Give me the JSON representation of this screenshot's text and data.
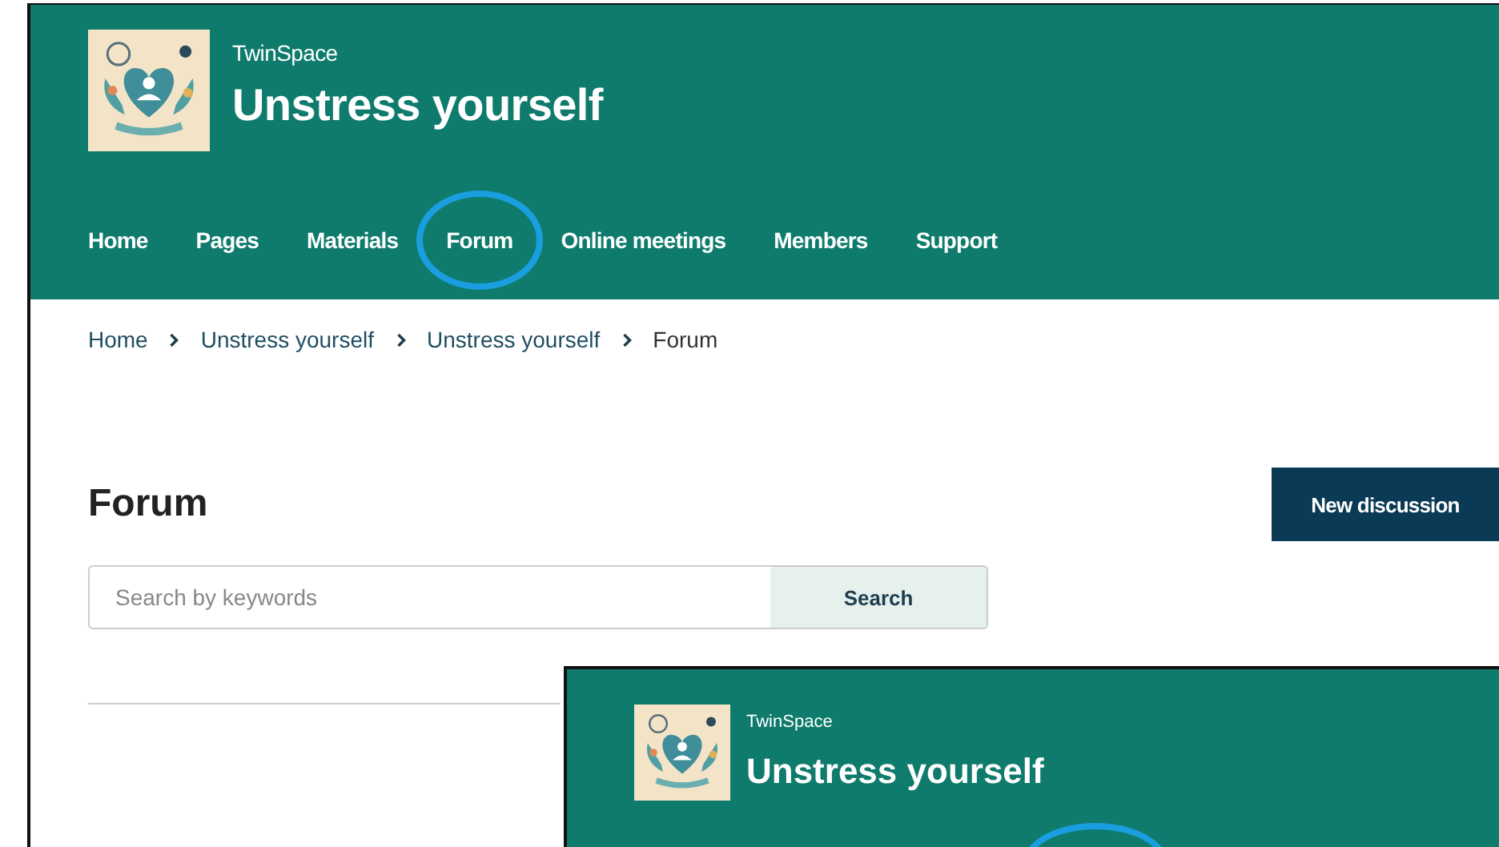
{
  "header": {
    "site_label": "TwinSpace",
    "title": "Unstress yourself"
  },
  "nav": [
    {
      "label": "Home",
      "highlighted": false
    },
    {
      "label": "Pages",
      "highlighted": false
    },
    {
      "label": "Materials",
      "highlighted": false
    },
    {
      "label": "Forum",
      "highlighted": true
    },
    {
      "label": "Online meetings",
      "highlighted": false
    },
    {
      "label": "Members",
      "highlighted": false
    },
    {
      "label": "Support",
      "highlighted": false
    }
  ],
  "breadcrumb": [
    {
      "label": "Home",
      "kind": "link"
    },
    {
      "label": "Unstress yourself",
      "kind": "link"
    },
    {
      "label": "Unstress yourself",
      "kind": "link"
    },
    {
      "label": "Forum",
      "kind": "current"
    }
  ],
  "page_title": "Forum",
  "new_button": "New discussion",
  "search": {
    "placeholder": "Search by keywords",
    "button": "Search"
  },
  "inset": {
    "site_label": "TwinSpace",
    "title": "Unstress yourself",
    "highlight_circle": true
  }
}
